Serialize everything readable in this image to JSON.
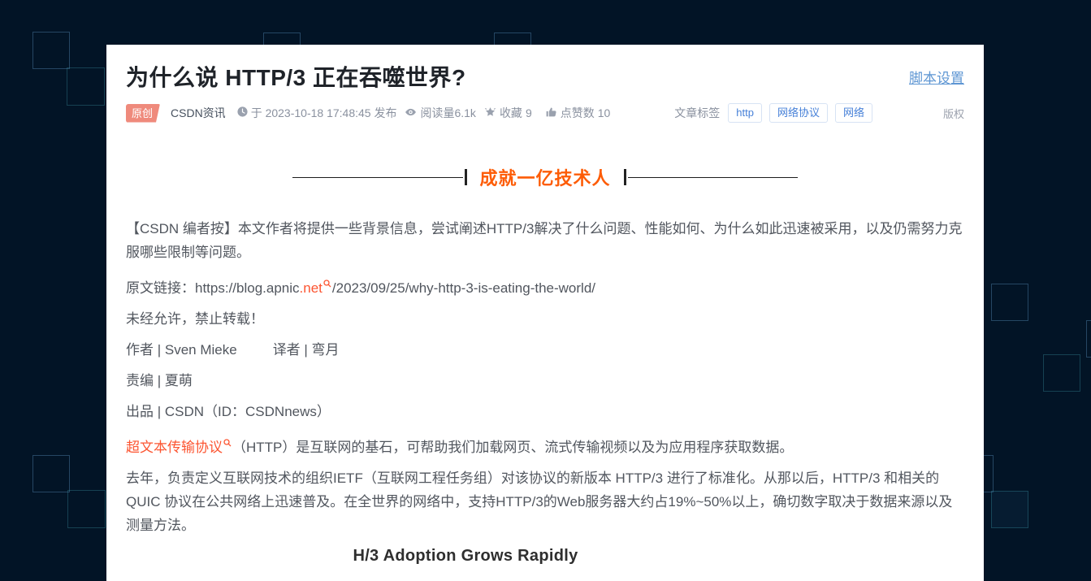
{
  "header": {
    "title": "为什么说 HTTP/3 正在吞噬世界?",
    "script_settings": "脚本设置"
  },
  "meta": {
    "original_badge": "原创",
    "author": "CSDN资讯",
    "publish_info": "于 2023-10-18 17:48:45 发布",
    "read_count": "阅读量6.1k",
    "favorite_label": "收藏",
    "favorite_count": "9",
    "like_label": "点赞数",
    "like_count": "10",
    "tags_label": "文章标签",
    "tags": [
      "http",
      "网络协议",
      "网络"
    ],
    "copyright": "版权"
  },
  "banner": {
    "slogan": "成就一亿技术人"
  },
  "article": {
    "editor_note": "【CSDN 编者按】本文作者将提供一些背景信息，尝试阐述HTTP/3解决了什么问题、性能如何、为什么如此迅速被采用，以及仍需努力克服哪些限制等问题。",
    "source_link": {
      "prefix": "原文链接：https://blog.apnic",
      "highlight": ".net",
      "suffix": "/2023/09/25/why-http-3-is-eating-the-world/"
    },
    "no_reprint": "未经允许，禁止转载！",
    "byline_author": "作者 | Sven Mieke",
    "byline_translator": "译者 | 弯月",
    "byline_editor": "责编 | 夏萌",
    "byline_publisher": "出品 | CSDN（ID：CSDNnews）",
    "http_intro": {
      "highlight": "超文本传输协议",
      "rest": "（HTTP）是互联网的基石，可帮助我们加载网页、流式传输视频以及为应用程序获取数据。"
    },
    "body_paragraph": "去年，负责定义互联网技术的组织IETF（互联网工程任务组）对该协议的新版本 HTTP/3 进行了标准化。从那以后，HTTP/3 和相关的 QUIC 协议在公共网络上迅速普及。在全世界的网络中，支持HTTP/3的Web服务器大约占19%~50%以上，确切数字取决于数据来源以及测量方法。",
    "chart_heading": "H/3 Adoption Grows Rapidly"
  },
  "colors": {
    "accent_orange": "#fd5c06",
    "highlight_red": "#fc5531",
    "link_blue": "#5e96d3",
    "tag_blue": "#4680d8",
    "meta_gray": "#8a919f",
    "background_navy": "#021426"
  }
}
